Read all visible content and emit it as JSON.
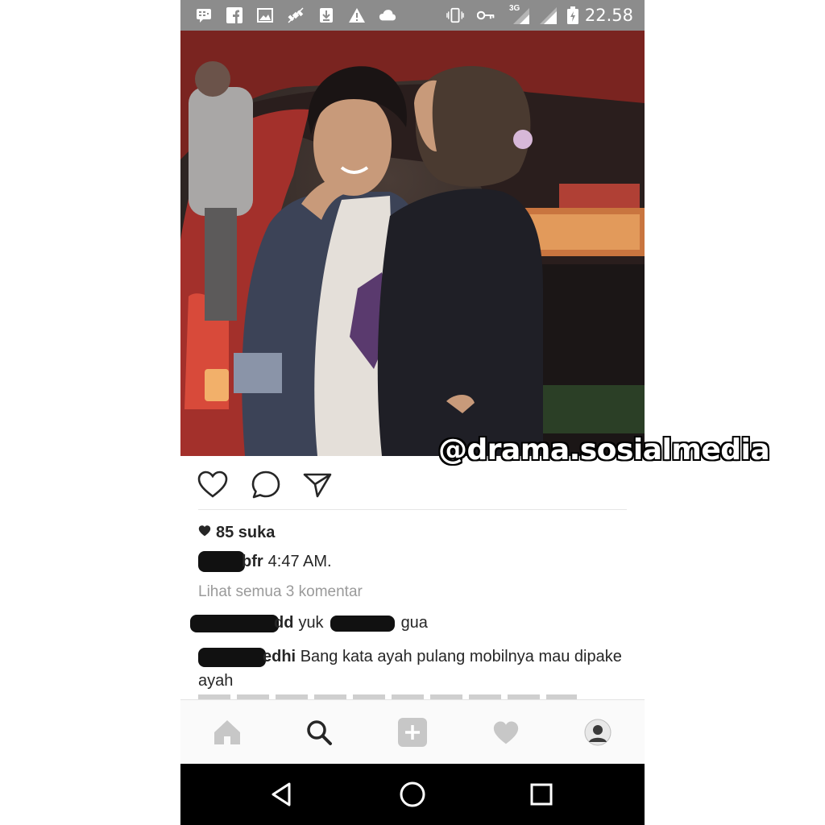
{
  "status_bar": {
    "time": "22.58",
    "network": "3G",
    "icons": [
      "bbm-icon",
      "facebook-icon",
      "image-icon",
      "satellite-icon",
      "download-icon",
      "warning-icon",
      "cloud-icon",
      "vibrate-icon",
      "key-icon",
      "signal-icon",
      "signal-icon",
      "battery-icon"
    ]
  },
  "watermark": "@drama.sosialmedia",
  "post": {
    "likes": "85 suka",
    "caption_user_suffix": "bfr",
    "caption_time": "4:47 AM.",
    "view_all_comments": "Lihat semua 3 komentar",
    "comments": [
      {
        "user_suffix": "dd",
        "text_before": "yuk",
        "text_after": "gua"
      },
      {
        "user_suffix": "edhi",
        "text": "Bang kata ayah pulang mobilnya mau dipake ayah"
      }
    ]
  },
  "colors": {
    "status_bar_bg": "#8c8c8c",
    "text": "#262626",
    "muted": "#9a9a9a",
    "tab_icon": "#c7c7c7",
    "nav_bg": "#000000"
  }
}
